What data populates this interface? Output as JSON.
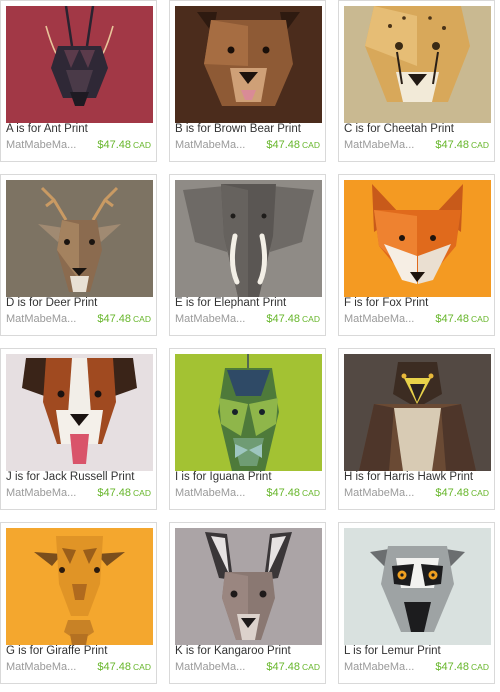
{
  "listings": [
    {
      "title": "A is for Ant Print",
      "shop": "MatMabeMa...",
      "price": "$47.48",
      "currency": "CAD",
      "bg": "#a23846",
      "icon": "ant-icon"
    },
    {
      "title": "B is for Brown Bear Print",
      "shop": "MatMabeMa...",
      "price": "$47.48",
      "currency": "CAD",
      "bg": "#4b2c1c",
      "icon": "bear-icon"
    },
    {
      "title": "C is for Cheetah Print",
      "shop": "MatMabeMa...",
      "price": "$47.48",
      "currency": "CAD",
      "bg": "#c9b991",
      "icon": "cheetah-icon"
    },
    {
      "title": "D is for Deer Print",
      "shop": "MatMabeMa...",
      "price": "$47.48",
      "currency": "CAD",
      "bg": "#7d7363",
      "icon": "deer-icon"
    },
    {
      "title": "E is for Elephant Print",
      "shop": "MatMabeMa...",
      "price": "$47.48",
      "currency": "CAD",
      "bg": "#8f8b86",
      "icon": "elephant-icon"
    },
    {
      "title": "F is for Fox Print",
      "shop": "MatMabeMa...",
      "price": "$47.48",
      "currency": "CAD",
      "bg": "#f49a22",
      "icon": "fox-icon"
    },
    {
      "title": "J is for Jack Russell Print",
      "shop": "MatMabeMa...",
      "price": "$47.48",
      "currency": "CAD",
      "bg": "#e6dfe1",
      "icon": "jack-russell-icon"
    },
    {
      "title": "I is for Iguana Print",
      "shop": "MatMabeMa...",
      "price": "$47.48",
      "currency": "CAD",
      "bg": "#a3c233",
      "icon": "iguana-icon"
    },
    {
      "title": "H is for Harris Hawk Print",
      "shop": "MatMabeMa...",
      "price": "$47.48",
      "currency": "CAD",
      "bg": "#534943",
      "icon": "hawk-icon"
    },
    {
      "title": "G is for Giraffe Print",
      "shop": "MatMabeMa...",
      "price": "$47.48",
      "currency": "CAD",
      "bg": "#f4a72e",
      "icon": "giraffe-icon"
    },
    {
      "title": "K is for Kangaroo Print",
      "shop": "MatMabeMa...",
      "price": "$47.48",
      "currency": "CAD",
      "bg": "#aba4a6",
      "icon": "kangaroo-icon"
    },
    {
      "title": "L is for Lemur Print",
      "shop": "MatMabeMa...",
      "price": "$47.48",
      "currency": "CAD",
      "bg": "#d9e1df",
      "icon": "lemur-icon"
    }
  ]
}
